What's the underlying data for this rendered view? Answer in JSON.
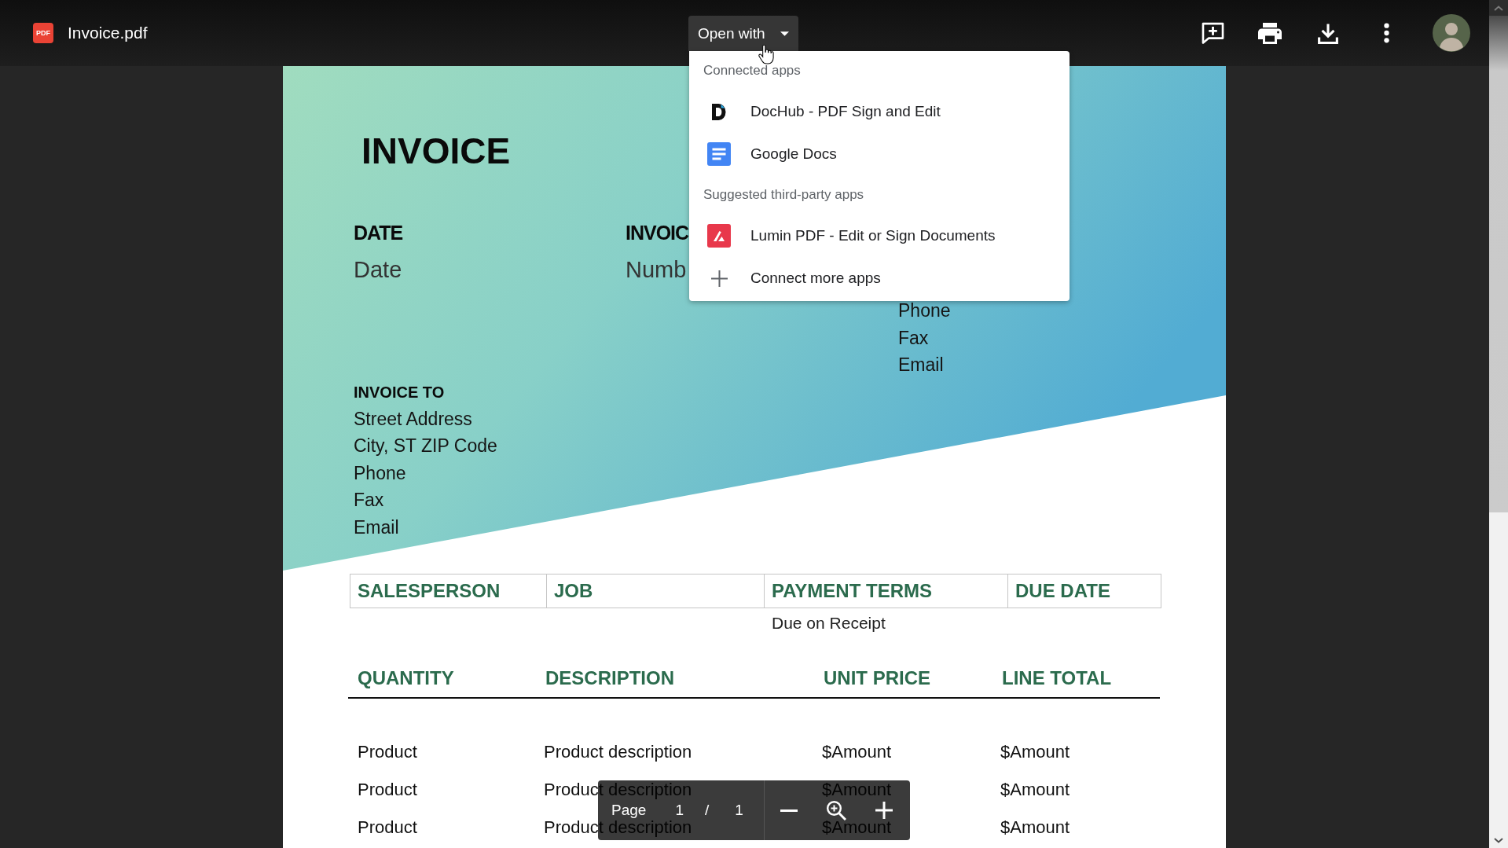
{
  "file": {
    "type_label": "PDF",
    "name": "Invoice.pdf"
  },
  "toolbar": {
    "open_with": "Open with"
  },
  "open_with_menu": {
    "sections": [
      {
        "heading": "Connected apps",
        "items": [
          {
            "label": "DocHub - PDF Sign and Edit",
            "kind": "dochub"
          },
          {
            "label": "Google Docs",
            "kind": "docs"
          }
        ]
      },
      {
        "heading": "Suggested third-party apps",
        "items": [
          {
            "label": "Lumin PDF - Edit or Sign Documents",
            "kind": "lumin"
          },
          {
            "label": "Connect more apps",
            "kind": "add"
          }
        ]
      }
    ]
  },
  "document": {
    "title": "INVOICE",
    "fields": [
      {
        "heading": "DATE",
        "value": "Date"
      },
      {
        "heading": "INVOIC",
        "value": "Numb"
      }
    ],
    "contact_lines": [
      "Phone",
      "Fax",
      "Email"
    ],
    "bill_to": {
      "heading": "INVOICE TO",
      "lines": [
        "Street Address",
        "City, ST ZIP Code",
        "Phone",
        "Fax",
        "Email"
      ]
    },
    "job_table": {
      "columns": [
        {
          "heading": "SALESPERSON"
        },
        {
          "heading": "JOB"
        },
        {
          "heading": "PAYMENT TERMS",
          "value": "Due on Receipt"
        },
        {
          "heading": "DUE DATE"
        }
      ]
    },
    "items_table": {
      "columns": [
        "QUANTITY",
        "DESCRIPTION",
        "UNIT PRICE",
        "LINE TOTAL"
      ],
      "rows": [
        [
          "Product",
          "Product description",
          "$Amount",
          "$Amount"
        ],
        [
          "Product",
          "Product description",
          "$Amount",
          "$Amount"
        ],
        [
          "Product",
          "Product description",
          "$Amount",
          "$Amount"
        ]
      ]
    }
  },
  "page_controls": {
    "label": "Page",
    "current": "1",
    "separator": "/",
    "total": "1"
  }
}
